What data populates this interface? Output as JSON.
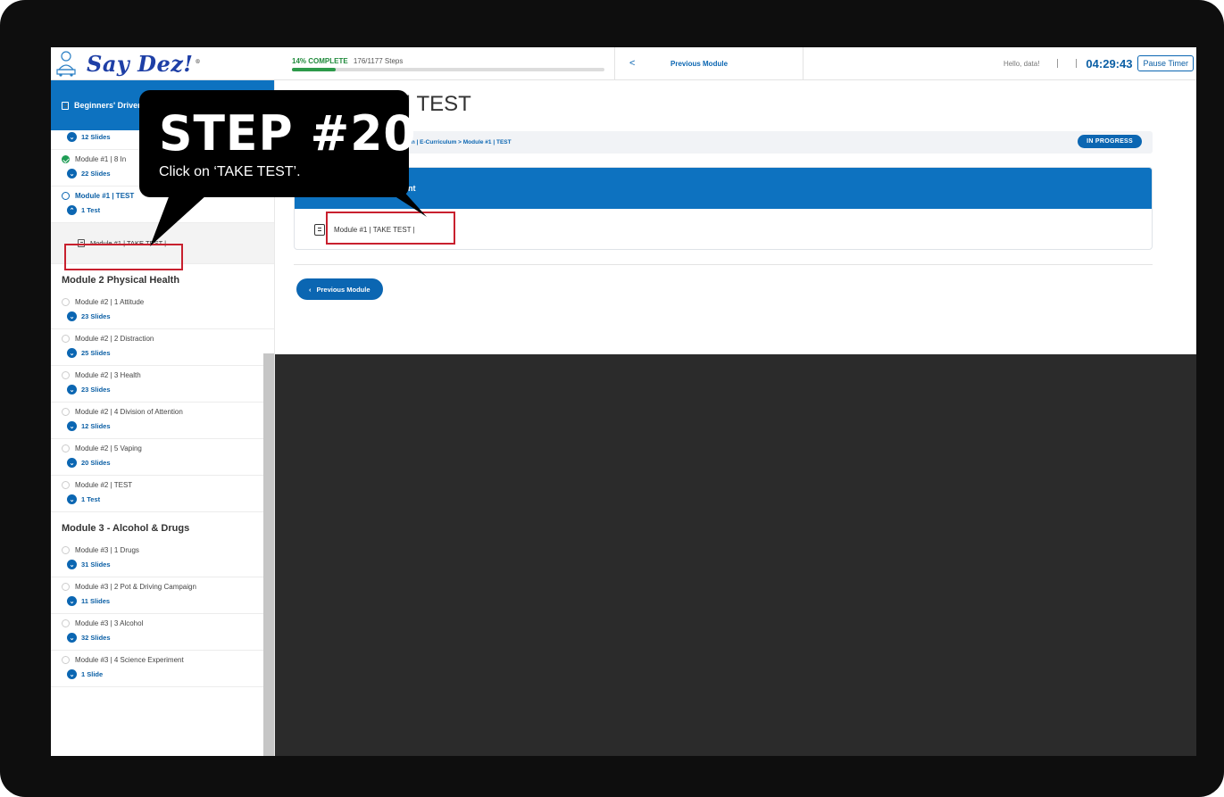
{
  "header": {
    "logo_text": "Say Dez!",
    "logo_tm": "®",
    "progress_percent_label": "14% COMPLETE",
    "progress_steps": "176/1177 Steps",
    "progress_fraction": 0.14,
    "prev_chevron": "<",
    "prev_label": "Previous Module",
    "hello": "Hello, data!",
    "timer": "04:29:43",
    "pause_label": "Pause Timer"
  },
  "sidebar": {
    "course_title": "Beginners' Driver",
    "items_top": [
      {
        "title": "",
        "sub": "12 Slides",
        "state": "none"
      },
      {
        "title": "Module #1 | 8 In",
        "sub": "22 Slides",
        "state": "done"
      },
      {
        "title": "Module #1 | TEST",
        "sub": "1 Test",
        "state": "current"
      }
    ],
    "subitem": "Module #1 | TAKE TEST |",
    "section2": "Module 2 Physical Health",
    "items_m2": [
      {
        "title": "Module #2 | 1 Attitude",
        "sub": "23 Slides"
      },
      {
        "title": "Module #2 | 2 Distraction",
        "sub": "25 Slides"
      },
      {
        "title": "Module #2 | 3 Health",
        "sub": "23 Slides"
      },
      {
        "title": "Module #2 | 4 Division of Attention",
        "sub": "12 Slides"
      },
      {
        "title": "Module #2 | 5 Vaping",
        "sub": "20 Slides"
      },
      {
        "title": "Module #2 | TEST",
        "sub": "1 Test"
      }
    ],
    "section3": "Module 3 - Alcohol & Drugs",
    "items_m3": [
      {
        "title": "Module #3 | 1 Drugs",
        "sub": "31 Slides"
      },
      {
        "title": "Module #3 | 2 Pot & Driving Campaign",
        "sub": "11 Slides"
      },
      {
        "title": "Module #3 | 3 Alcohol",
        "sub": "32 Slides"
      },
      {
        "title": "Module #3 | 4 Science Experiment",
        "sub": "1 Slide"
      }
    ]
  },
  "main": {
    "title": "| TEST",
    "breadcrumb": "ion | E-Curriculum > Module #1 | TEST",
    "status": "IN PROGRESS",
    "card_header": "nt",
    "card_item": "Module #1 | TAKE TEST |",
    "prev_button": "Previous Module"
  },
  "callout": {
    "title": "STEP #20",
    "description": "Click on ‘TAKE TEST’."
  },
  "colors": {
    "accent": "#0d72c0",
    "progress": "#2d9a4a",
    "highlight": "#c8202e"
  }
}
